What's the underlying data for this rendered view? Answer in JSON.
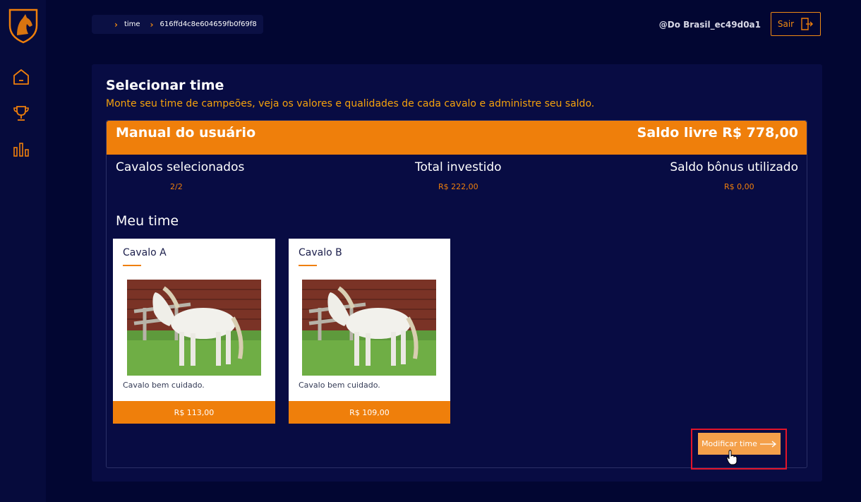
{
  "breadcrumb": {
    "items": [
      "time",
      "616ffd4c8e604659fb0f69f8"
    ]
  },
  "header": {
    "user": "@Do Brasil_ec49d0a1",
    "logout_label": "Sair"
  },
  "sidebar": {
    "items": [
      "home-icon",
      "trophy-icon",
      "chart-icon"
    ]
  },
  "page": {
    "title": "Selecionar time",
    "subtitle": "Monte seu time de campeões, veja os valores e qualidades de cada cavalo e administre seu saldo."
  },
  "summary": {
    "manual_label": "Manual do usuário",
    "balance": "Saldo livre R$ 778,00",
    "stats": [
      {
        "label": "Cavalos selecionados",
        "value": "2/2"
      },
      {
        "label": "Total investido",
        "value": "R$ 222,00"
      },
      {
        "label": "Saldo bônus utilizado",
        "value": "R$ 0,00"
      }
    ]
  },
  "team": {
    "title": "Meu time",
    "horses": [
      {
        "name": "Cavalo A",
        "description": "Cavalo bem cuidado.",
        "price": "R$ 113,00"
      },
      {
        "name": "Cavalo B",
        "description": "Cavalo bem cuidado.",
        "price": "R$ 109,00"
      }
    ]
  },
  "actions": {
    "modify_label": "Modificar time"
  },
  "colors": {
    "accent": "#ef7f0b",
    "background": "#020632",
    "panel": "#080c43"
  }
}
